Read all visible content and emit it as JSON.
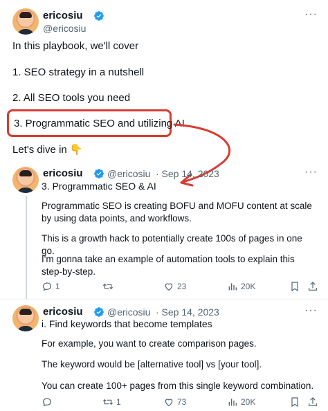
{
  "main_tweet": {
    "name": "ericosiu",
    "handle": "@ericosiu",
    "lines": [
      "In this playbook, we'll cover",
      "1. SEO strategy in a nutshell",
      "2. All SEO tools you need",
      "3. Programmatic SEO and utilizing AI",
      "Let's dive in 👇"
    ]
  },
  "reply1": {
    "name": "ericosiu",
    "handle": "@ericosiu",
    "date": "· Sep 14, 2023",
    "title": "3. Programmatic SEO & AI",
    "para1": "Programmatic SEO is creating BOFU and MOFU content at scale by using data points, and workflows.",
    "para2": "This is a growth hack to potentially create 100s of pages in one go.",
    "para3": "I'm gonna take an example of automation tools to explain this step-by-step.",
    "replies": "1",
    "retweets": "",
    "likes": "23",
    "views": "20K"
  },
  "reply2": {
    "name": "ericosiu",
    "handle": "@ericosiu",
    "date": "· Sep 14, 2023",
    "title": "i. Find keywords that become templates",
    "para1": "For example, you want to create comparison pages.",
    "para2": "The keyword would be [alternative tool] vs [your tool].",
    "para3": "You can create 100+ pages from this single keyword combination.",
    "replies": "",
    "retweets": "1",
    "likes": "73",
    "views": "20K"
  },
  "colors": {
    "highlight_border": "#d93b30",
    "arrow": "#d93b30",
    "verified": "#1d9bf0",
    "muted": "#536471"
  },
  "icons": [
    "verified-badge-icon",
    "more-options-icon",
    "reply-icon",
    "retweet-icon",
    "like-icon",
    "views-icon",
    "bookmark-icon",
    "share-icon"
  ]
}
